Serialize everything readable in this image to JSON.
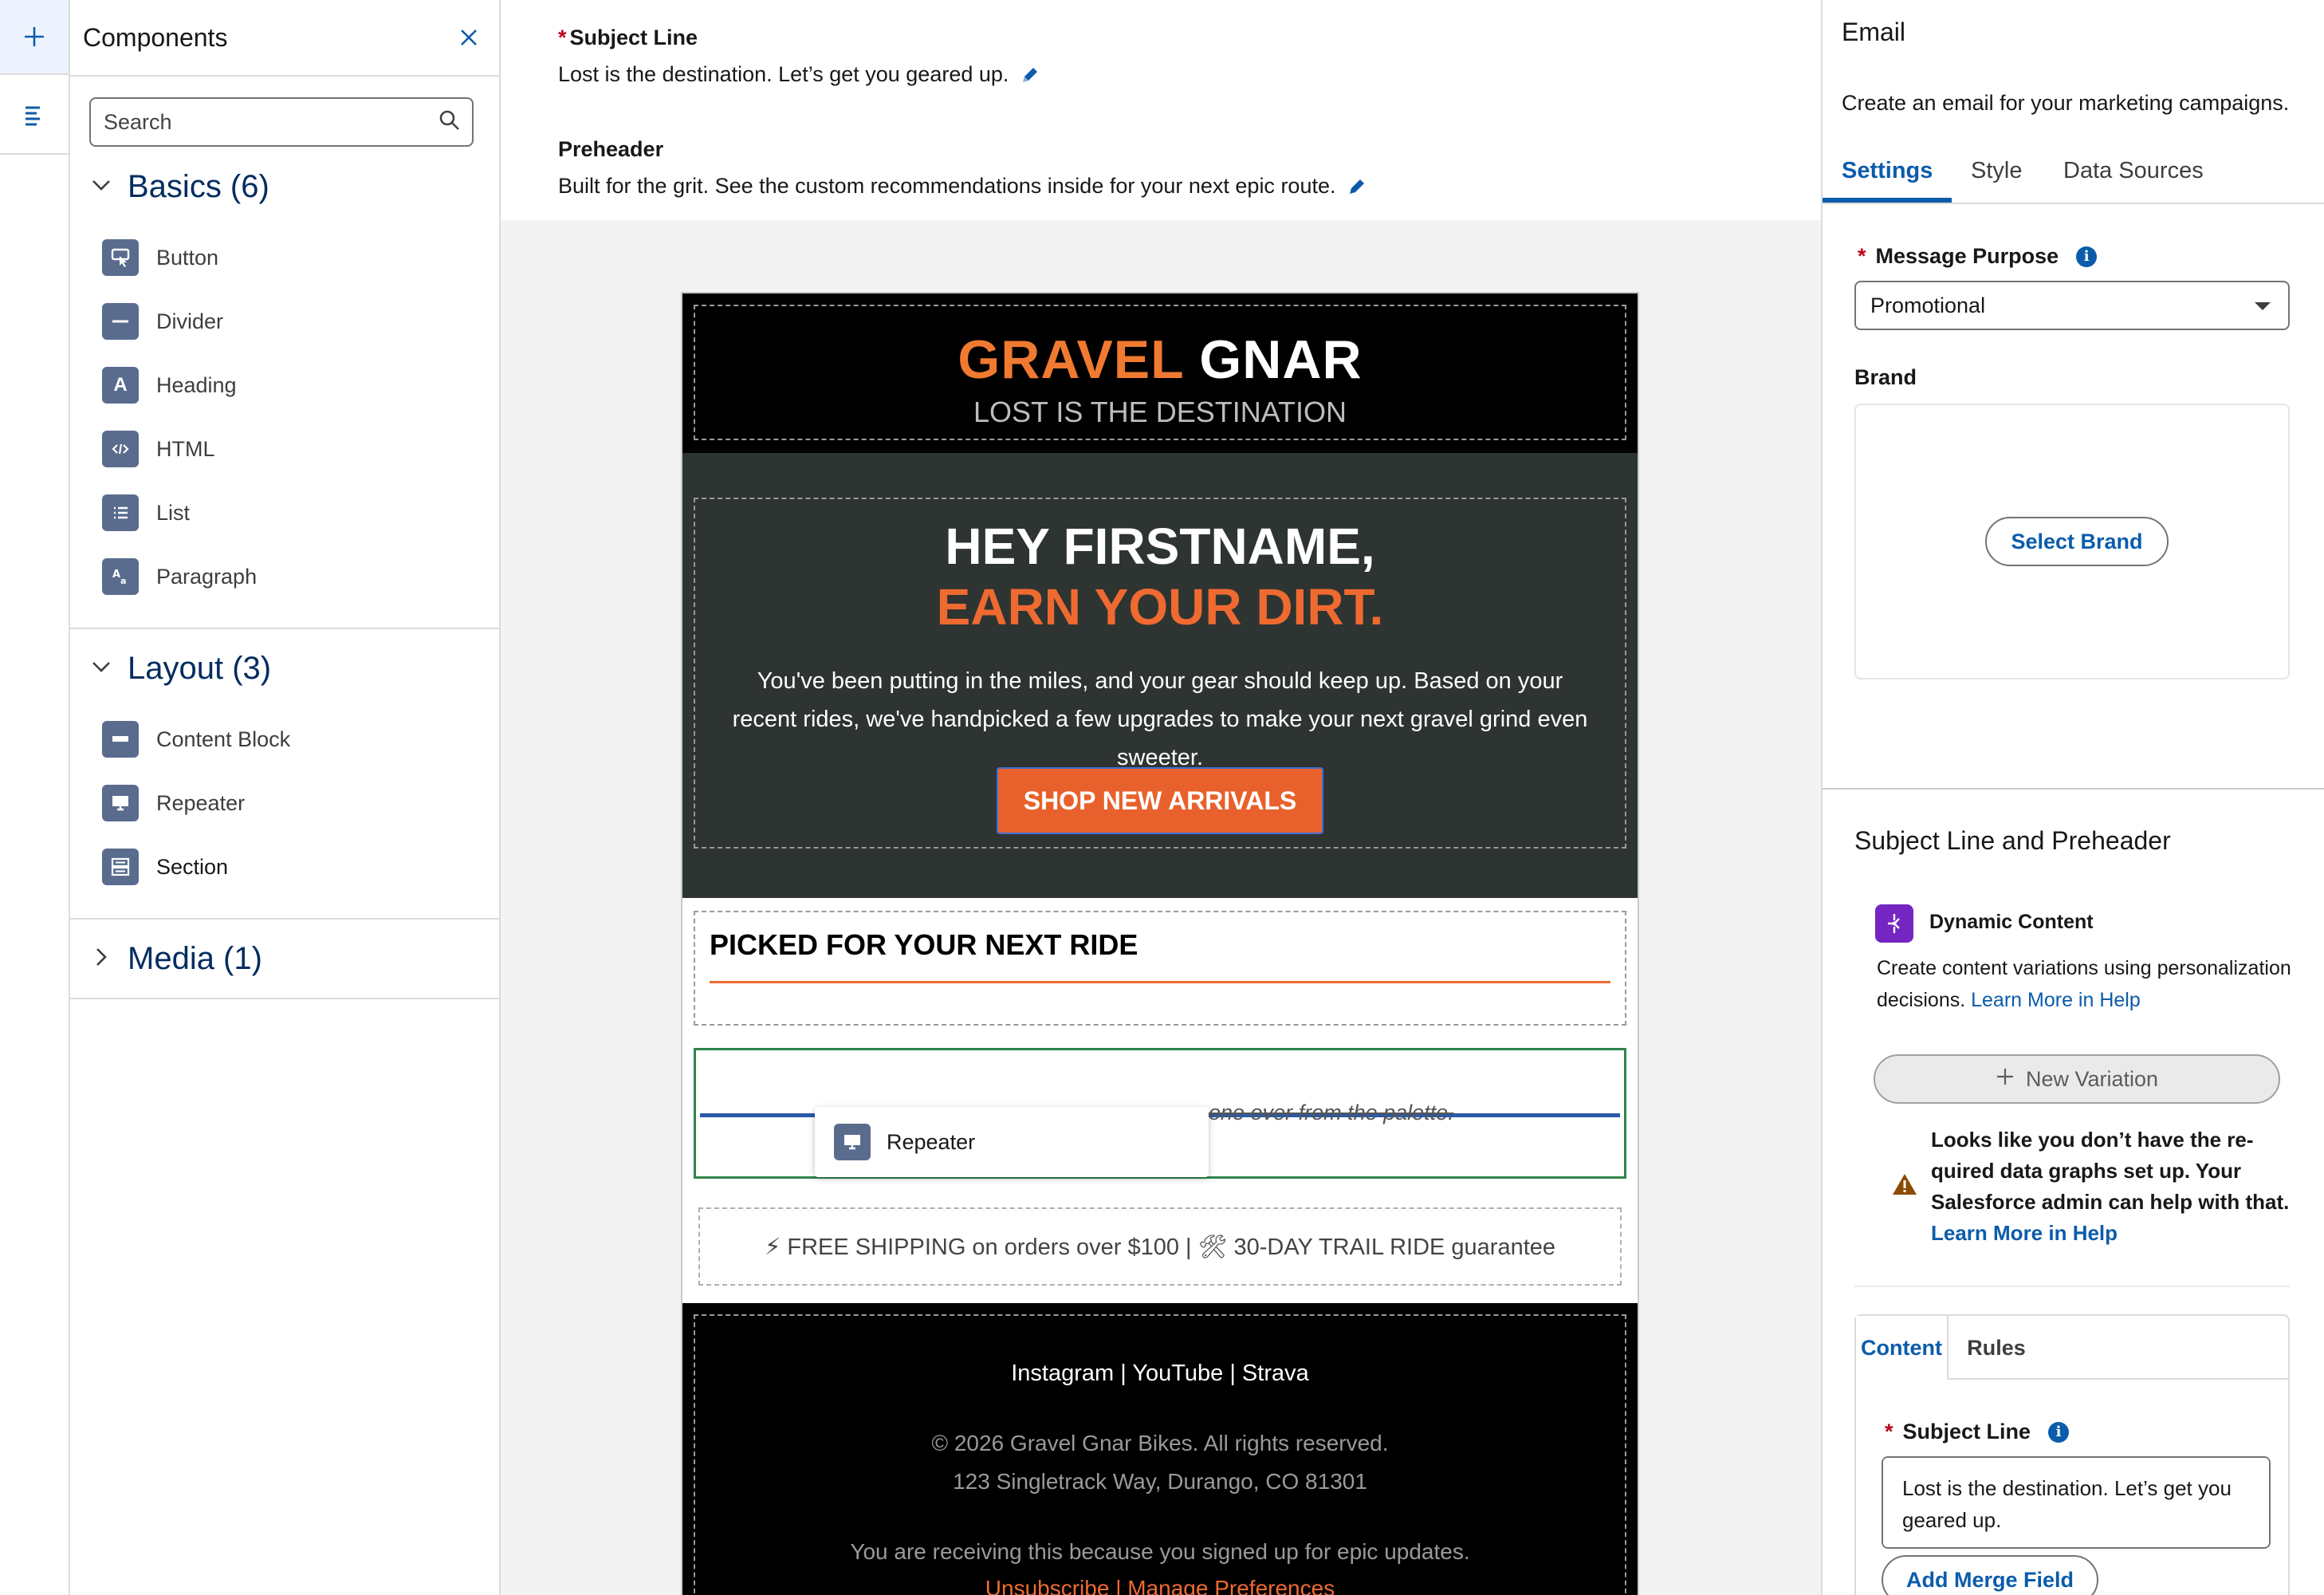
{
  "rail": {
    "add_icon": "plus-icon",
    "list_icon": "list-icon"
  },
  "components": {
    "title": "Components",
    "search_placeholder": "Search",
    "groups": [
      {
        "label": "Basics (6)",
        "expanded": true,
        "items": [
          {
            "label": "Button",
            "icon": "button-icon"
          },
          {
            "label": "Divider",
            "icon": "divider-icon"
          },
          {
            "label": "Heading",
            "icon": "heading-icon"
          },
          {
            "label": "HTML",
            "icon": "html-icon"
          },
          {
            "label": "List",
            "icon": "list-icon"
          },
          {
            "label": "Paragraph",
            "icon": "paragraph-icon"
          }
        ]
      },
      {
        "label": "Layout (3)",
        "expanded": true,
        "items": [
          {
            "label": "Content Block",
            "icon": "content-block-icon"
          },
          {
            "label": "Repeater",
            "icon": "repeater-icon"
          },
          {
            "label": "Section",
            "icon": "section-icon"
          }
        ]
      },
      {
        "label": "Media (1)",
        "expanded": false,
        "items": []
      }
    ]
  },
  "header_props": {
    "subject_label": "Subject Line",
    "subject_value": "Lost is the destination. Let’s get you geared up.",
    "preheader_label": "Preheader",
    "preheader_value": "Built for the grit. See the custom recommendations inside for your next epic route."
  },
  "email": {
    "logo_part1": "GRAVEL",
    "logo_part2": "GNAR",
    "tagline": "LOST IS THE DESTINATION",
    "hero_line1": "HEY FIRSTNAME,",
    "hero_line2": "EARN YOUR DIRT.",
    "hero_body": "You've been putting in the miles, and your gear should keep up. Based on your recent rides, we've handpicked a few upgrades to make your next gravel grind even sweeter.",
    "cta_label": "SHOP NEW ARRIVALS",
    "picked_title": "PICKED FOR YOUR NEXT RIDE",
    "drop_text": "one over from the palette.",
    "drag_label": "Repeater",
    "shipping_text": "⚡ FREE SHIPPING on orders over $100 | 🛠 30-DAY TRAIL RIDE guarantee",
    "social": "Instagram | YouTube | Strava",
    "copyright": "© 2026 Gravel Gnar Bikes. All rights reserved.",
    "address": "123 Singletrack Way, Durango, CO 81301",
    "receiving": "You are receiving this because you signed up for epic updates.",
    "unsubscribe": "Unsubscribe",
    "link_sep": " | ",
    "manage": "Manage Preferences",
    "colors": {
      "brand_orange": "#f07a30",
      "hero_bg": "#2e3431",
      "cta_bg": "#e8612c"
    }
  },
  "right_panel": {
    "title": "Email",
    "description": "Create an email for your marketing campaigns.",
    "tabs": [
      "Settings",
      "Style",
      "Data Sources"
    ],
    "active_tab": "Settings",
    "message_purpose_label": "Message Purpose",
    "message_purpose_value": "Promotional",
    "brand_label": "Brand",
    "select_brand": "Select Brand",
    "slp_title": "Subject Line and Preheader",
    "dynamic_title": "Dynamic Content",
    "dynamic_desc": "Create content variations using personalization decisions.",
    "dynamic_link": "Learn More in Help",
    "new_variation": "New Variation",
    "warning_text": "Looks like you don’t have the re- quired data graphs set up. Your Salesforce admin can help with that.",
    "warning_link": "Learn More in Help",
    "card_tabs": [
      "Content",
      "Rules"
    ],
    "subject_label": "Subject Line",
    "subject_value": "Lost is the destination. Let’s get you geared up.",
    "merge_field": "Add Merge Field",
    "accent_color": "#0b5cab"
  }
}
